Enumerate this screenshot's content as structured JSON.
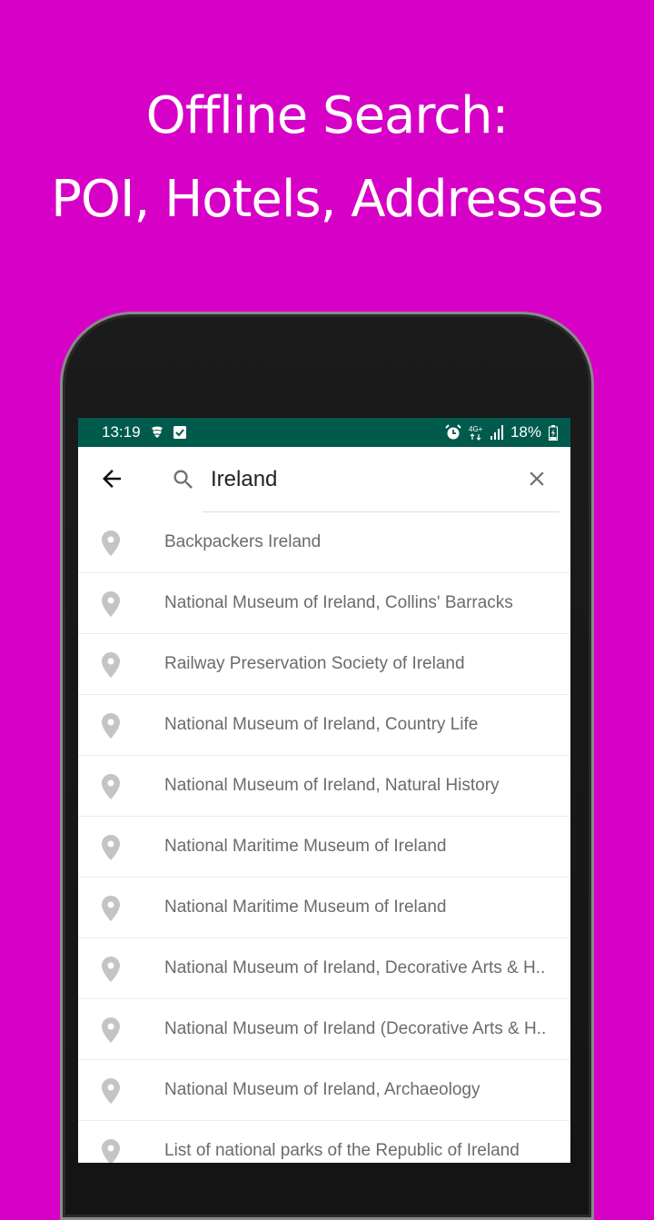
{
  "promo": {
    "headline_line1": "Offline Search:",
    "headline_line2": "POI, Hotels, Addresses",
    "background_color": "#d600c6"
  },
  "status_bar": {
    "time": "13:19",
    "left_icons": [
      "notification-app-icon",
      "checkbox-notification-icon"
    ],
    "right_icons": [
      "alarm-icon",
      "4g-plus-icon",
      "signal-icon"
    ],
    "battery_percent": "18%",
    "battery_icon": "battery-charging-icon",
    "color": "#005b4d"
  },
  "search": {
    "back_icon": "arrow-left-icon",
    "search_icon": "search-icon",
    "query": "Ireland",
    "clear_icon": "close-icon"
  },
  "results": [
    {
      "icon": "map-pin-icon",
      "label": "Backpackers Ireland"
    },
    {
      "icon": "map-pin-icon",
      "label": "National Museum of Ireland, Collins' Barracks"
    },
    {
      "icon": "map-pin-icon",
      "label": "Railway Preservation Society of Ireland"
    },
    {
      "icon": "map-pin-icon",
      "label": "National Museum of Ireland, Country Life"
    },
    {
      "icon": "map-pin-icon",
      "label": "National Museum of Ireland, Natural History"
    },
    {
      "icon": "map-pin-icon",
      "label": "National Maritime Museum of Ireland"
    },
    {
      "icon": "map-pin-icon",
      "label": "National Maritime Museum of Ireland"
    },
    {
      "icon": "map-pin-icon",
      "label": "National Museum of Ireland, Decorative Arts & H.."
    },
    {
      "icon": "map-pin-icon",
      "label": "National Museum of Ireland (Decorative Arts & H.."
    },
    {
      "icon": "map-pin-icon",
      "label": "National Museum of Ireland, Archaeology"
    },
    {
      "icon": "map-pin-icon",
      "label": "List of national parks of the Republic of Ireland"
    }
  ]
}
